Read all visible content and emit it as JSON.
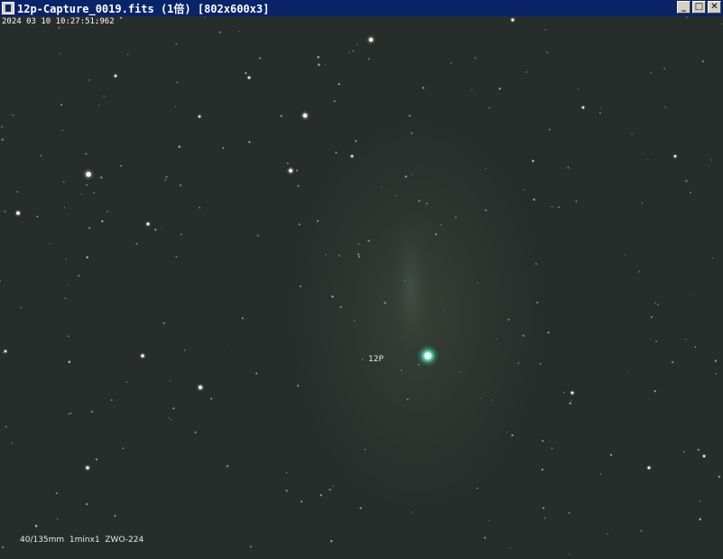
{
  "window": {
    "title": "12p-Capture_0019.fits (1倍) [802x600x3]",
    "buttons": {
      "minimize": "_",
      "maximize": "□",
      "close": "✕"
    }
  },
  "image": {
    "timestamp": "2024 03 10 10:27:51:962",
    "comet_label": "12P",
    "caption": "40/135mm  1minx1  ZWO-224"
  },
  "colors": {
    "titlebar": "#0a246a",
    "sky_background": "#272d2b",
    "comet_core": "#8cffd8"
  }
}
